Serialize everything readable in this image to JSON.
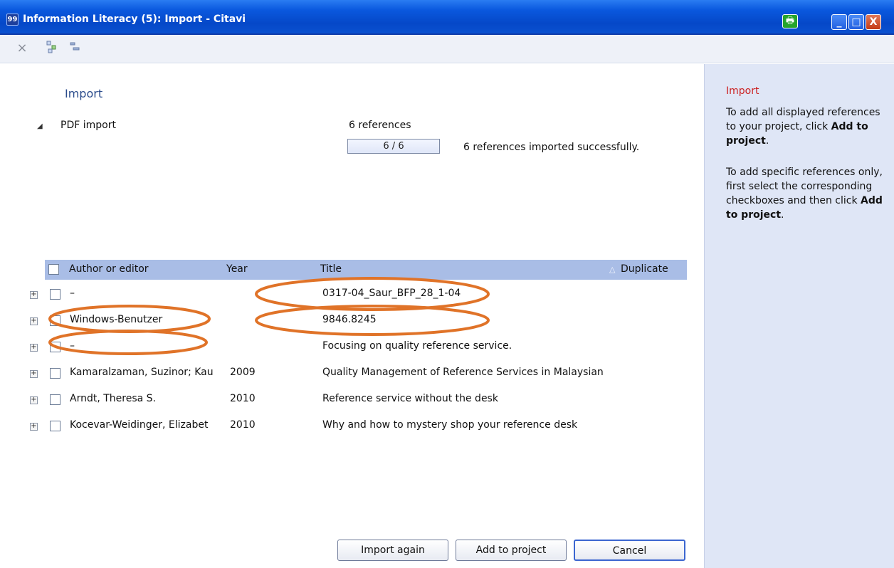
{
  "window": {
    "app_icon": "citavi-icon",
    "title": "Information Literacy (5): Import - Citavi",
    "min_label": "_",
    "max_label": "□",
    "close_label": "X"
  },
  "toolbar": {
    "delete_icon": "×",
    "expand_icon": "⁝",
    "collapse_icon": "="
  },
  "main": {
    "heading": "Import",
    "section_arrow": "◢",
    "section_label": "PDF import",
    "ref_count": "6 references",
    "progress_text": "6 / 6",
    "progress_fraction": 1.0,
    "status_text": "6 references imported successfully."
  },
  "table": {
    "headers": {
      "author": "Author or editor",
      "year": "Year",
      "title": "Title",
      "duplicate": "Duplicate",
      "sort_icon": "△"
    },
    "rows": [
      {
        "author": "–",
        "year": "",
        "title": "0317-04_Saur_BFP_28_1-04"
      },
      {
        "author": "Windows-Benutzer",
        "year": "",
        "title": "9846.8245"
      },
      {
        "author": "–",
        "year": "",
        "title": "Focusing on quality reference service."
      },
      {
        "author": "Kamaralzaman, Suzinor; Kau",
        "year": "2009",
        "title": "Quality Management of Reference Services in Malaysian"
      },
      {
        "author": "Arndt, Theresa S.",
        "year": "2010",
        "title": "Reference service without the desk"
      },
      {
        "author": "Kocevar-Weidinger, Elizabet",
        "year": "2010",
        "title": "Why and how to mystery shop your reference desk"
      }
    ]
  },
  "buttons": {
    "import_again": "Import again",
    "add_to_project": "Add to project",
    "cancel": "Cancel"
  },
  "help": {
    "title": "Import",
    "p1_text": "To add all displayed references to your project, click",
    "p1_bold": "Add to project",
    "p1_end": ".",
    "p2_text": "To add specific references only, first select the corresponding checkboxes and then click",
    "p2_bold": "Add to project",
    "p2_end": "."
  },
  "colors": {
    "titlebar": "#0548c8",
    "header_row": "#a9bde6",
    "help_panel": "#dfe6f6",
    "annotation_oval": "#e07328",
    "help_title": "#cc2222"
  }
}
